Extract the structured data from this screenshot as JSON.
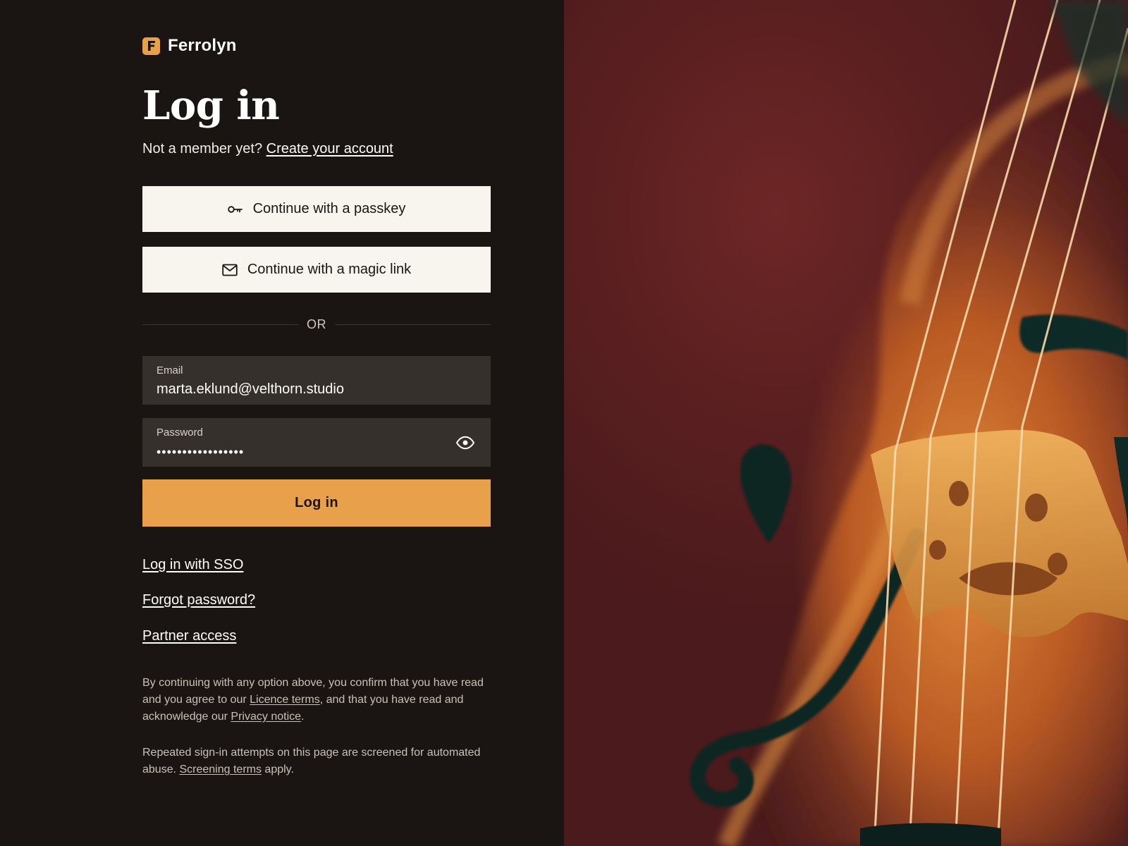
{
  "brand": {
    "name": "Ferrolyn",
    "mark_letter": "F",
    "accent": "#e8a04a"
  },
  "page": {
    "title": "Log in",
    "signup_prompt": "Not a member yet?",
    "signup_link": "Create your account"
  },
  "alt_auth": {
    "passkey_label": "Continue with a passkey",
    "passkey_icon": "key-icon",
    "magic_label": "Continue with a magic link",
    "magic_icon": "envelope-icon"
  },
  "divider": {
    "label": "OR"
  },
  "form": {
    "email": {
      "label": "Email",
      "value": "marta.eklund@velthorn.studio"
    },
    "password": {
      "label": "Password",
      "value": "•••••••••••••••••",
      "toggle_icon": "eye-icon"
    },
    "submit_label": "Log in"
  },
  "links": {
    "sso": "Log in with SSO",
    "forgot": "Forgot password?",
    "partner": "Partner access"
  },
  "legal": {
    "p1_a": "By continuing with any option above, you confirm that you have read and you agree to our ",
    "p1_licence": "Licence terms",
    "p1_b": ", and that you have read and acknowledge our ",
    "p1_privacy": "Privacy notice",
    "p1_c": ".",
    "p2_a": "Repeated sign-in attempts on this page are screened for automated abuse. ",
    "p2_link": "Screening terms",
    "p2_b": " apply."
  },
  "hero": {
    "subject": "cello-bridge-and-strings-photo"
  },
  "colors": {
    "background": "#1a1512",
    "field_bg": "#35302b",
    "alt_button_bg": "#f8f4ee"
  }
}
